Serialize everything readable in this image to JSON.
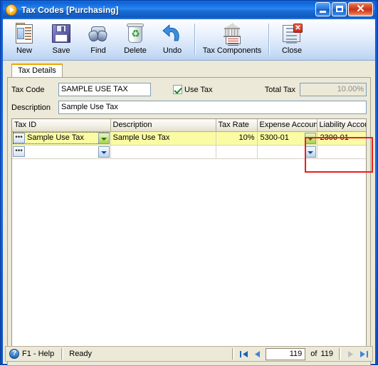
{
  "window": {
    "title": "Tax Codes [Purchasing]",
    "icon": "app-play-circle-icon",
    "controls": {
      "minimize": "minimize-button",
      "maximize": "maximize-button",
      "close": "close-button"
    }
  },
  "toolbar": {
    "items": [
      {
        "label": "New",
        "icon": "new-document-icon"
      },
      {
        "label": "Save",
        "icon": "floppy-disk-icon"
      },
      {
        "label": "Find",
        "icon": "binoculars-icon"
      },
      {
        "label": "Delete",
        "icon": "recycle-bin-icon"
      },
      {
        "label": "Undo",
        "icon": "undo-arrow-icon"
      },
      {
        "label": "Tax Components",
        "icon": "bank-building-icon"
      },
      {
        "label": "Close",
        "icon": "document-close-icon"
      }
    ]
  },
  "tabs": [
    {
      "label": "Tax Details",
      "active": true
    }
  ],
  "form": {
    "tax_code_label": "Tax Code",
    "tax_code_value": "SAMPLE USE TAX",
    "use_tax_label": "Use Tax",
    "use_tax_checked": true,
    "total_tax_label": "Total Tax",
    "total_tax_value": "10.00%",
    "description_label": "Description",
    "description_value": "Sample Use Tax"
  },
  "grid": {
    "columns": [
      "Tax ID",
      "Description",
      "Tax Rate",
      "Expense Accoun",
      "Liability Account"
    ],
    "rows": [
      {
        "selected": true,
        "tax_id": "Sample Use Tax",
        "description": "Sample Use Tax",
        "tax_rate": "10%",
        "expense_account": "5300-01",
        "liability_account": "2300-01"
      },
      {
        "selected": false,
        "tax_id": "",
        "description": "",
        "tax_rate": "",
        "expense_account": "",
        "liability_account": ""
      }
    ]
  },
  "annotation": {
    "highlight_color": "#ee1c1c",
    "target": "Liability Account"
  },
  "statusbar": {
    "help_text": "F1 - Help",
    "status_text": "Ready",
    "current_record": "119",
    "of_label": "of",
    "total_records": "119"
  },
  "colors": {
    "titlebar_blue": "#1567e8",
    "client_beige": "#ece9d8",
    "selected_row_yellow": "#fbfba4",
    "tab_accent_orange": "#f0a400"
  }
}
